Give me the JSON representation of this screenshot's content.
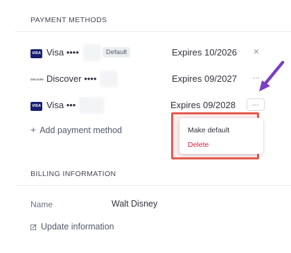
{
  "payment_methods": {
    "heading": "PAYMENT METHODS",
    "items": [
      {
        "brand": "VISA",
        "name": "Visa",
        "masked": "••••",
        "badge": "Default",
        "expires": "Expires 10/2026",
        "action": "×"
      },
      {
        "brand": "DISCOVER",
        "name": "Discover",
        "masked": "••••",
        "expires": "Expires 09/2027",
        "action": "···"
      },
      {
        "brand": "VISA",
        "name": "Visa",
        "masked": "•••",
        "expires": "Expires 09/2028",
        "action": "···"
      }
    ],
    "add_label": "Add payment method",
    "menu": {
      "make_default": "Make default",
      "delete": "Delete"
    }
  },
  "billing": {
    "heading": "BILLING INFORMATION",
    "name_label": "Name",
    "name_value": "Walt Disney",
    "update_label": "Update information"
  },
  "colors": {
    "delete": "#df1b41",
    "highlight": "#e45a4d",
    "arrow": "#7b3fc4"
  }
}
